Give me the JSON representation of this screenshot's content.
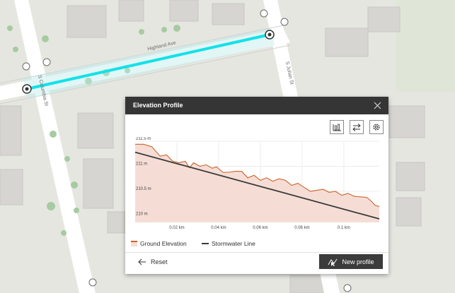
{
  "map": {
    "street_labels": {
      "highland": "Highland Ave",
      "julian": "S Julian St",
      "columbia": "S Columbia St"
    }
  },
  "panel": {
    "title": "Elevation Profile",
    "close_icon": "close-icon",
    "toolbar": {
      "icons": [
        "bar-chart-icon",
        "swap-icon",
        "gear-icon"
      ]
    },
    "legend": {
      "ground": "Ground Elevation",
      "stormwater": "Stormwater Line"
    },
    "reset_label": "Reset",
    "new_profile_label": "New profile"
  },
  "chart_data": {
    "type": "line",
    "xlabel": "",
    "ylabel": "",
    "xlim": [
      0,
      0.117
    ],
    "ylim": [
      209.88,
      211.5
    ],
    "y_ticks": [
      {
        "value": 211.5,
        "label": "211.5 m"
      },
      {
        "value": 211,
        "label": "211 m"
      },
      {
        "value": 210.5,
        "label": "210.5 m"
      },
      {
        "value": 210,
        "label": "210 m"
      }
    ],
    "x_ticks": [
      {
        "value": 0.02,
        "label": "0.02 km"
      },
      {
        "value": 0.04,
        "label": "0.04 km"
      },
      {
        "value": 0.06,
        "label": "0.06 km"
      },
      {
        "value": 0.08,
        "label": "0.08 km"
      },
      {
        "value": 0.1,
        "label": "0.1 km"
      }
    ],
    "series": [
      {
        "name": "Ground Elevation",
        "color": "#c9622a",
        "fill": "#f5ddd5",
        "x": [
          0,
          0.004,
          0.008,
          0.012,
          0.015,
          0.018,
          0.021,
          0.024,
          0.026,
          0.028,
          0.031,
          0.034,
          0.037,
          0.039,
          0.042,
          0.045,
          0.048,
          0.051,
          0.054,
          0.057,
          0.06,
          0.063,
          0.066,
          0.069,
          0.072,
          0.075,
          0.078,
          0.081,
          0.084,
          0.087,
          0.09,
          0.093,
          0.096,
          0.099,
          0.102,
          0.105,
          0.108,
          0.111,
          0.113,
          0.115,
          0.117
        ],
        "values": [
          211.44,
          211.44,
          211.39,
          211.2,
          211.23,
          211.1,
          211.07,
          211.1,
          210.97,
          211.07,
          211.0,
          211.03,
          210.96,
          210.99,
          210.88,
          210.88,
          210.9,
          210.9,
          210.77,
          210.82,
          210.72,
          210.77,
          210.7,
          210.75,
          210.72,
          210.62,
          210.66,
          210.58,
          210.5,
          210.52,
          210.54,
          210.48,
          210.5,
          210.42,
          210.46,
          210.4,
          210.39,
          210.38,
          210.31,
          210.22,
          210.2
        ]
      },
      {
        "name": "Stormwater Line",
        "color": "#3b3b3b",
        "x": [
          0,
          0.117
        ],
        "values": [
          211.28,
          209.95
        ]
      }
    ]
  }
}
